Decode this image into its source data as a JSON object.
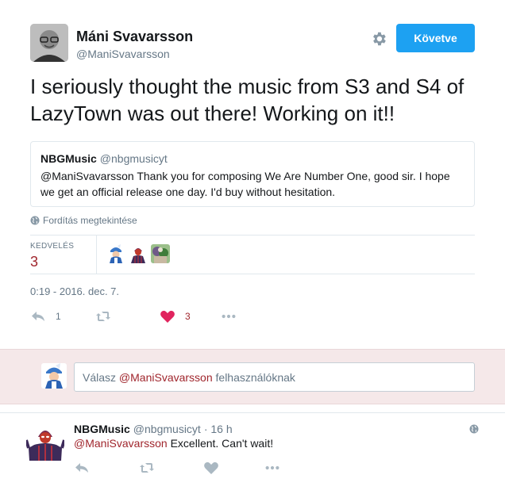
{
  "tweet": {
    "author_name": "Máni Svavarsson",
    "author_handle": "@ManiSvavarsson",
    "follow_label": "Követve",
    "text": "I seriously thought the music from S3 and S4 of LazyTown was out there!  Working on it!!",
    "quote": {
      "name": "NBGMusic",
      "handle": "@nbgmusicyt",
      "text": "@ManiSvavarsson Thank you for composing We Are Number One, good sir. I hope we get an official release one day. I'd buy without hesitation."
    },
    "translate_label": "Fordítás megtekintése",
    "likes_label": "KEDVELÉS",
    "likes_count": "3",
    "timestamp": "0:19 - 2016. dec. 7.",
    "actions": {
      "reply_count": "1",
      "like_count": "3"
    }
  },
  "reply_composer": {
    "prefix": "Válasz ",
    "mention": "@ManiSvavarsson",
    "suffix": " felhasználóknak"
  },
  "reply_tweet": {
    "name": "NBGMusic",
    "handle": "@nbgmusicyt",
    "time": "· 16 h",
    "mention": "@ManiSvavarsson",
    "text": " Excellent. Can't wait!"
  },
  "colors": {
    "accent": "#1da1f2",
    "link": "#a0262d",
    "like": "#e0245e",
    "muted": "#657786",
    "reply_bg": "#f5e8e9"
  }
}
